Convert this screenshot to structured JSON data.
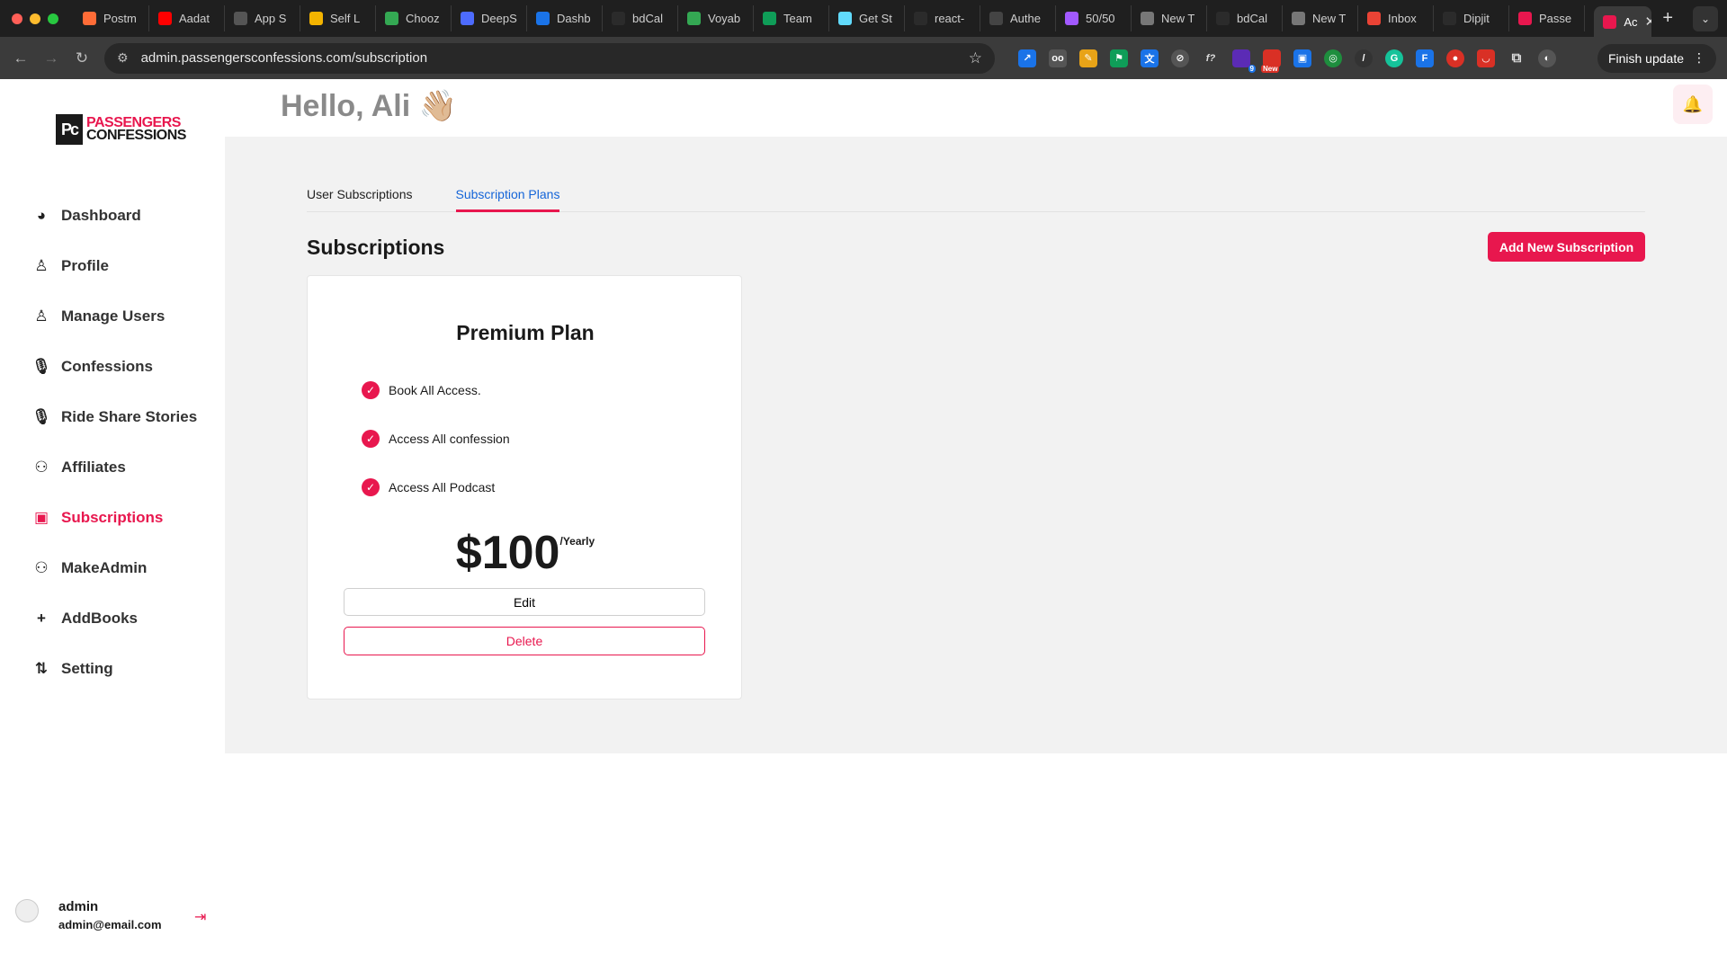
{
  "browser": {
    "tabs": [
      {
        "label": "Postm",
        "icon": "postman-icon",
        "color": "#ff6c37"
      },
      {
        "label": "Aadat",
        "icon": "youtube-icon",
        "color": "#ff0000"
      },
      {
        "label": "App S",
        "icon": "apple-icon",
        "color": "#555555"
      },
      {
        "label": "Self L",
        "icon": "self-learn-icon",
        "color": "#f4b400"
      },
      {
        "label": "Chooz",
        "icon": "drive-icon",
        "color": "#34a853"
      },
      {
        "label": "DeepS",
        "icon": "deepseek-icon",
        "color": "#4d6bfe"
      },
      {
        "label": "Dashb",
        "icon": "dashboard-icon",
        "color": "#1a73e8"
      },
      {
        "label": "bdCal",
        "icon": "github-icon",
        "color": "#2b2b2b"
      },
      {
        "label": "Voyab",
        "icon": "drive-icon",
        "color": "#34a853"
      },
      {
        "label": "Team",
        "icon": "sheets-icon",
        "color": "#0f9d58"
      },
      {
        "label": "Get St",
        "icon": "react-icon",
        "color": "#61dafb"
      },
      {
        "label": "react-",
        "icon": "github-icon",
        "color": "#2b2b2b"
      },
      {
        "label": "Authe",
        "icon": "openai-icon",
        "color": "#444444"
      },
      {
        "label": "50/50",
        "icon": "figma-icon",
        "color": "#a259ff"
      },
      {
        "label": "New T",
        "icon": "chrome-icon",
        "color": "#777777"
      },
      {
        "label": "bdCal",
        "icon": "github-icon",
        "color": "#2b2b2b"
      },
      {
        "label": "New T",
        "icon": "chrome-icon",
        "color": "#777777"
      },
      {
        "label": "Inbox",
        "icon": "gmail-icon",
        "color": "#ea4335"
      },
      {
        "label": "Dipjit",
        "icon": "github-icon",
        "color": "#2b2b2b"
      },
      {
        "label": "Passe",
        "icon": "passengers-icon",
        "color": "#e8174e"
      }
    ],
    "active_tab": {
      "label": "Ac",
      "icon": "passengers-icon"
    },
    "url": "admin.passengersconfessions.com/subscription",
    "finish_update": "Finish update",
    "ext_badges": {
      "badge_9": "9",
      "badge_new": "New"
    }
  },
  "logo": {
    "mark": "Pc",
    "line1": "PASSENGERS",
    "line2": "CONFESSIONS"
  },
  "sidebar": {
    "items": [
      {
        "label": "Dashboard",
        "icon": "pie-chart-icon"
      },
      {
        "label": "Profile",
        "icon": "user-icon"
      },
      {
        "label": "Manage Users",
        "icon": "user-icon"
      },
      {
        "label": "Confessions",
        "icon": "microphone-icon"
      },
      {
        "label": "Ride Share Stories",
        "icon": "microphone-icon"
      },
      {
        "label": "Affiliates",
        "icon": "user-plus-icon"
      },
      {
        "label": "Subscriptions",
        "icon": "subscription-icon"
      },
      {
        "label": "MakeAdmin",
        "icon": "user-plus-icon"
      },
      {
        "label": "AddBooks",
        "icon": "plus-icon"
      },
      {
        "label": "Setting",
        "icon": "sliders-icon"
      }
    ],
    "user": {
      "name": "admin",
      "email": "admin@email.com"
    }
  },
  "header": {
    "greeting": "Hello, Ali 👋🏼"
  },
  "main": {
    "tabs": [
      {
        "label": "User Subscriptions",
        "active": false
      },
      {
        "label": "Subscription Plans",
        "active": true
      }
    ],
    "title": "Subscriptions",
    "add_button": "Add New Subscription",
    "plans": [
      {
        "name": "Premium Plan",
        "features": [
          "Book All Access.",
          "Access All confession",
          "Access All Podcast"
        ],
        "price": "$100",
        "period": "/Yearly",
        "edit_label": "Edit",
        "delete_label": "Delete"
      }
    ]
  },
  "colors": {
    "accent": "#e8174e",
    "link_blue": "#1565d8",
    "content_bg": "#f2f2f2"
  }
}
